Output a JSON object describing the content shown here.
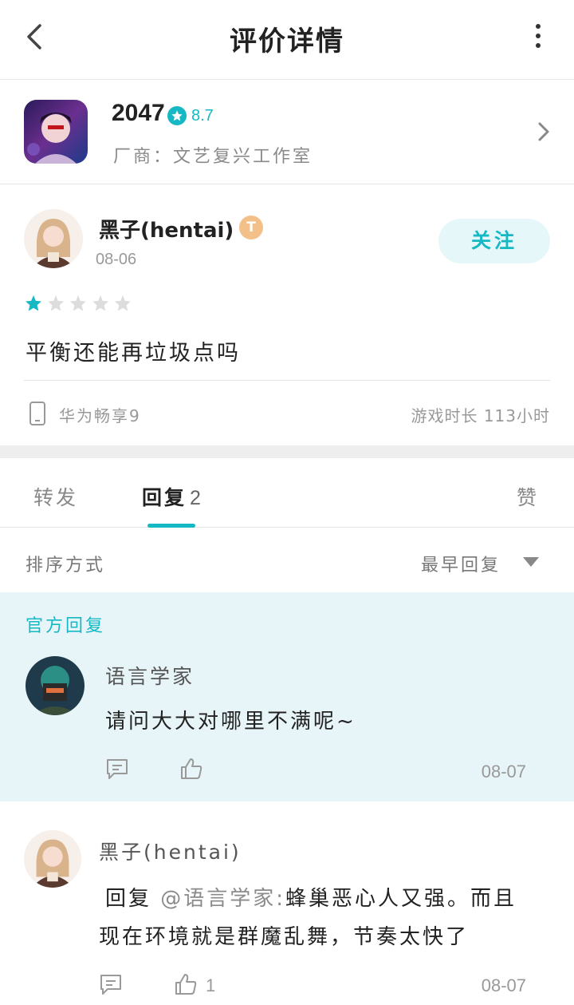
{
  "header": {
    "title": "评价详情"
  },
  "game": {
    "name": "2047",
    "rating": "8.7",
    "developer_label": "厂商：",
    "developer": "文艺复兴工作室"
  },
  "review": {
    "user_name": "黑子(hentai)",
    "level_badge": "T",
    "date": "08-06",
    "follow_label": "关注",
    "stars_filled": 1,
    "stars_total": 5,
    "text": "平衡还能再垃圾点吗",
    "device": "华为畅享9",
    "playtime": "游戏时长 113小时"
  },
  "tabs": {
    "forward": "转发",
    "reply": "回复",
    "reply_count": "2",
    "like": "赞"
  },
  "sort": {
    "label": "排序方式",
    "value": "最早回复"
  },
  "official_reply": {
    "section_label": "官方回复",
    "user_name": "语言学家",
    "text": "请问大大对哪里不满呢~",
    "date": "08-07"
  },
  "reply2": {
    "user_name": "黑子(hentai)",
    "reply_prefix": "回复",
    "mention": "@语言学家:",
    "text_line1": "蜂巢恶心人又强。而且",
    "text_line2": "现在环境就是群魔乱舞，节奏太快了",
    "like_count": "1",
    "date": "08-07"
  },
  "colors": {
    "accent": "#16b8c4",
    "official_bg": "#e7f5f9",
    "follow_bg": "#e5f7f9"
  }
}
